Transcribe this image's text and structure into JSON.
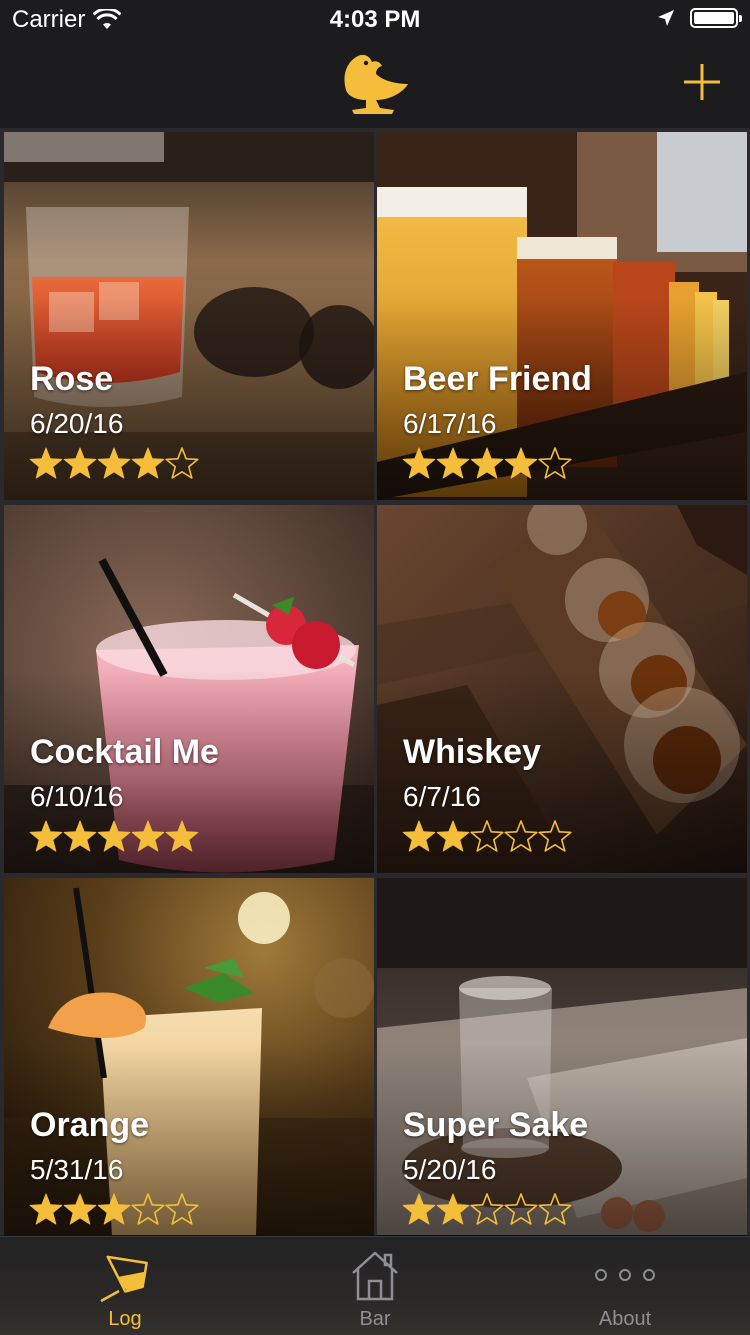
{
  "status": {
    "carrier": "Carrier",
    "time": "4:03 PM",
    "battery_level": 1.0
  },
  "colors": {
    "accent": "#f4be3a",
    "inactive": "#8e8e93"
  },
  "nav": {
    "logo_icon": "bird-logo-icon",
    "add_icon": "plus-icon"
  },
  "drinks": [
    {
      "name": "Rose",
      "date": "6/20/16",
      "rating": 4
    },
    {
      "name": "Beer Friend",
      "date": "6/17/16",
      "rating": 4
    },
    {
      "name": "Cocktail Me",
      "date": "6/10/16",
      "rating": 5
    },
    {
      "name": "Whiskey",
      "date": "6/7/16",
      "rating": 2
    },
    {
      "name": "Orange",
      "date": "5/31/16",
      "rating": 3
    },
    {
      "name": "Super Sake",
      "date": "5/20/16",
      "rating": 2
    }
  ],
  "tabs": [
    {
      "label": "Log",
      "icon": "glass-icon",
      "active": true
    },
    {
      "label": "Bar",
      "icon": "house-icon",
      "active": false
    },
    {
      "label": "About",
      "icon": "more-dots-icon",
      "active": false
    }
  ]
}
